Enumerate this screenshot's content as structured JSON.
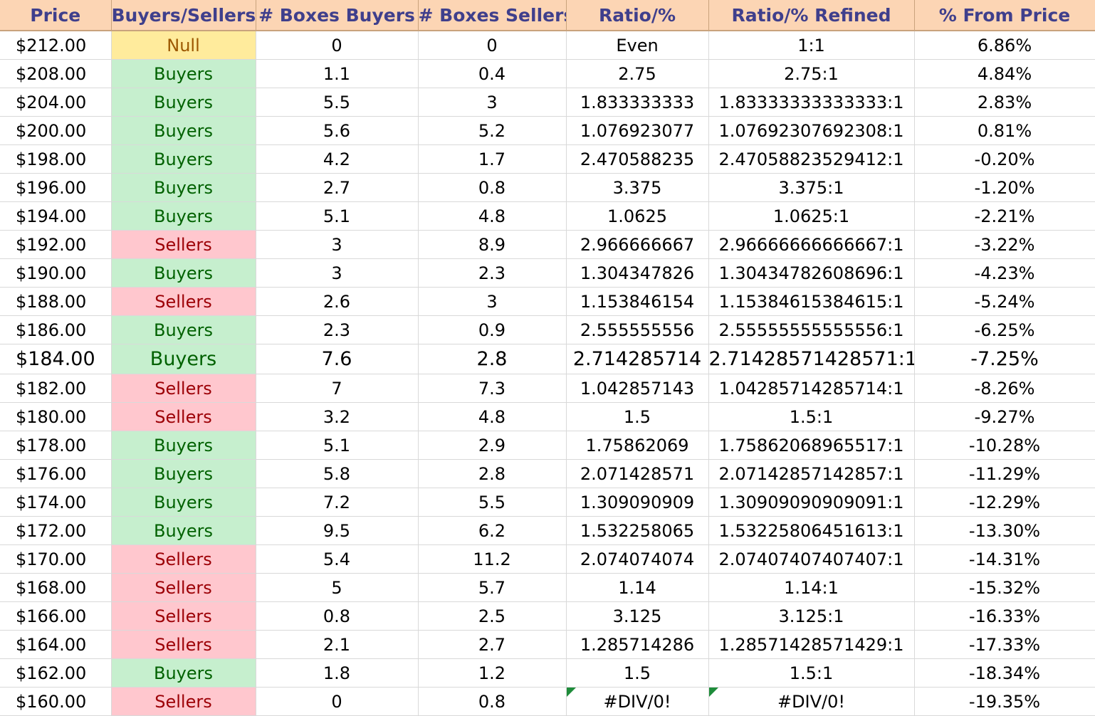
{
  "headers": {
    "price": "Price",
    "buyers_sellers": "Buyers/Sellers",
    "boxes_buyers": "# Boxes Buyers",
    "boxes_sellers": "# Boxes Sellers",
    "ratio": "Ratio/%",
    "ratio_refined": "Ratio/% Refined",
    "from_price": "% From Price"
  },
  "status_colors": {
    "Buyers": {
      "fill": "#c6efce",
      "text": "#006100"
    },
    "Sellers": {
      "fill": "#ffc7ce",
      "text": "#9c0006"
    },
    "Null": {
      "fill": "#ffeb9c",
      "text": "#9c5700"
    },
    "header": {
      "fill": "#fcd5b4",
      "text": "#3f3f8c"
    }
  },
  "rows": [
    {
      "price": "$212.00",
      "side": "Null",
      "boxes_buyers": "0",
      "boxes_sellers": "0",
      "ratio": "Even",
      "ratio_refined": "1:1",
      "from_price": "6.86%"
    },
    {
      "price": "$208.00",
      "side": "Buyers",
      "boxes_buyers": "1.1",
      "boxes_sellers": "0.4",
      "ratio": "2.75",
      "ratio_refined": "2.75:1",
      "from_price": "4.84%"
    },
    {
      "price": "$204.00",
      "side": "Buyers",
      "boxes_buyers": "5.5",
      "boxes_sellers": "3",
      "ratio": "1.833333333",
      "ratio_refined": "1.83333333333333:1",
      "from_price": "2.83%"
    },
    {
      "price": "$200.00",
      "side": "Buyers",
      "boxes_buyers": "5.6",
      "boxes_sellers": "5.2",
      "ratio": "1.076923077",
      "ratio_refined": "1.07692307692308:1",
      "from_price": "0.81%"
    },
    {
      "price": "$198.00",
      "side": "Buyers",
      "boxes_buyers": "4.2",
      "boxes_sellers": "1.7",
      "ratio": "2.470588235",
      "ratio_refined": "2.47058823529412:1",
      "from_price": "-0.20%"
    },
    {
      "price": "$196.00",
      "side": "Buyers",
      "boxes_buyers": "2.7",
      "boxes_sellers": "0.8",
      "ratio": "3.375",
      "ratio_refined": "3.375:1",
      "from_price": "-1.20%"
    },
    {
      "price": "$194.00",
      "side": "Buyers",
      "boxes_buyers": "5.1",
      "boxes_sellers": "4.8",
      "ratio": "1.0625",
      "ratio_refined": "1.0625:1",
      "from_price": "-2.21%"
    },
    {
      "price": "$192.00",
      "side": "Sellers",
      "boxes_buyers": "3",
      "boxes_sellers": "8.9",
      "ratio": "2.966666667",
      "ratio_refined": "2.96666666666667:1",
      "from_price": "-3.22%"
    },
    {
      "price": "$190.00",
      "side": "Buyers",
      "boxes_buyers": "3",
      "boxes_sellers": "2.3",
      "ratio": "1.304347826",
      "ratio_refined": "1.30434782608696:1",
      "from_price": "-4.23%"
    },
    {
      "price": "$188.00",
      "side": "Sellers",
      "boxes_buyers": "2.6",
      "boxes_sellers": "3",
      "ratio": "1.153846154",
      "ratio_refined": "1.15384615384615:1",
      "from_price": "-5.24%"
    },
    {
      "price": "$186.00",
      "side": "Buyers",
      "boxes_buyers": "2.3",
      "boxes_sellers": "0.9",
      "ratio": "2.555555556",
      "ratio_refined": "2.55555555555556:1",
      "from_price": "-6.25%"
    },
    {
      "price": "$184.00",
      "side": "Buyers",
      "boxes_buyers": "7.6",
      "boxes_sellers": "2.8",
      "ratio": "2.714285714",
      "ratio_refined": "2.71428571428571:1",
      "from_price": "-7.25%",
      "emphasized": true
    },
    {
      "price": "$182.00",
      "side": "Sellers",
      "boxes_buyers": "7",
      "boxes_sellers": "7.3",
      "ratio": "1.042857143",
      "ratio_refined": "1.04285714285714:1",
      "from_price": "-8.26%"
    },
    {
      "price": "$180.00",
      "side": "Sellers",
      "boxes_buyers": "3.2",
      "boxes_sellers": "4.8",
      "ratio": "1.5",
      "ratio_refined": "1.5:1",
      "from_price": "-9.27%"
    },
    {
      "price": "$178.00",
      "side": "Buyers",
      "boxes_buyers": "5.1",
      "boxes_sellers": "2.9",
      "ratio": "1.75862069",
      "ratio_refined": "1.75862068965517:1",
      "from_price": "-10.28%"
    },
    {
      "price": "$176.00",
      "side": "Buyers",
      "boxes_buyers": "5.8",
      "boxes_sellers": "2.8",
      "ratio": "2.071428571",
      "ratio_refined": "2.07142857142857:1",
      "from_price": "-11.29%"
    },
    {
      "price": "$174.00",
      "side": "Buyers",
      "boxes_buyers": "7.2",
      "boxes_sellers": "5.5",
      "ratio": "1.309090909",
      "ratio_refined": "1.30909090909091:1",
      "from_price": "-12.29%"
    },
    {
      "price": "$172.00",
      "side": "Buyers",
      "boxes_buyers": "9.5",
      "boxes_sellers": "6.2",
      "ratio": "1.532258065",
      "ratio_refined": "1.53225806451613:1",
      "from_price": "-13.30%"
    },
    {
      "price": "$170.00",
      "side": "Sellers",
      "boxes_buyers": "5.4",
      "boxes_sellers": "11.2",
      "ratio": "2.074074074",
      "ratio_refined": "2.07407407407407:1",
      "from_price": "-14.31%"
    },
    {
      "price": "$168.00",
      "side": "Sellers",
      "boxes_buyers": "5",
      "boxes_sellers": "5.7",
      "ratio": "1.14",
      "ratio_refined": "1.14:1",
      "from_price": "-15.32%"
    },
    {
      "price": "$166.00",
      "side": "Sellers",
      "boxes_buyers": "0.8",
      "boxes_sellers": "2.5",
      "ratio": "3.125",
      "ratio_refined": "3.125:1",
      "from_price": "-16.33%"
    },
    {
      "price": "$164.00",
      "side": "Sellers",
      "boxes_buyers": "2.1",
      "boxes_sellers": "2.7",
      "ratio": "1.285714286",
      "ratio_refined": "1.28571428571429:1",
      "from_price": "-17.33%"
    },
    {
      "price": "$162.00",
      "side": "Buyers",
      "boxes_buyers": "1.8",
      "boxes_sellers": "1.2",
      "ratio": "1.5",
      "ratio_refined": "1.5:1",
      "from_price": "-18.34%"
    },
    {
      "price": "$160.00",
      "side": "Sellers",
      "boxes_buyers": "0",
      "boxes_sellers": "0.8",
      "ratio": "#DIV/0!",
      "ratio_refined": "#DIV/0!",
      "from_price": "-19.35%",
      "error_flags": true
    }
  ]
}
